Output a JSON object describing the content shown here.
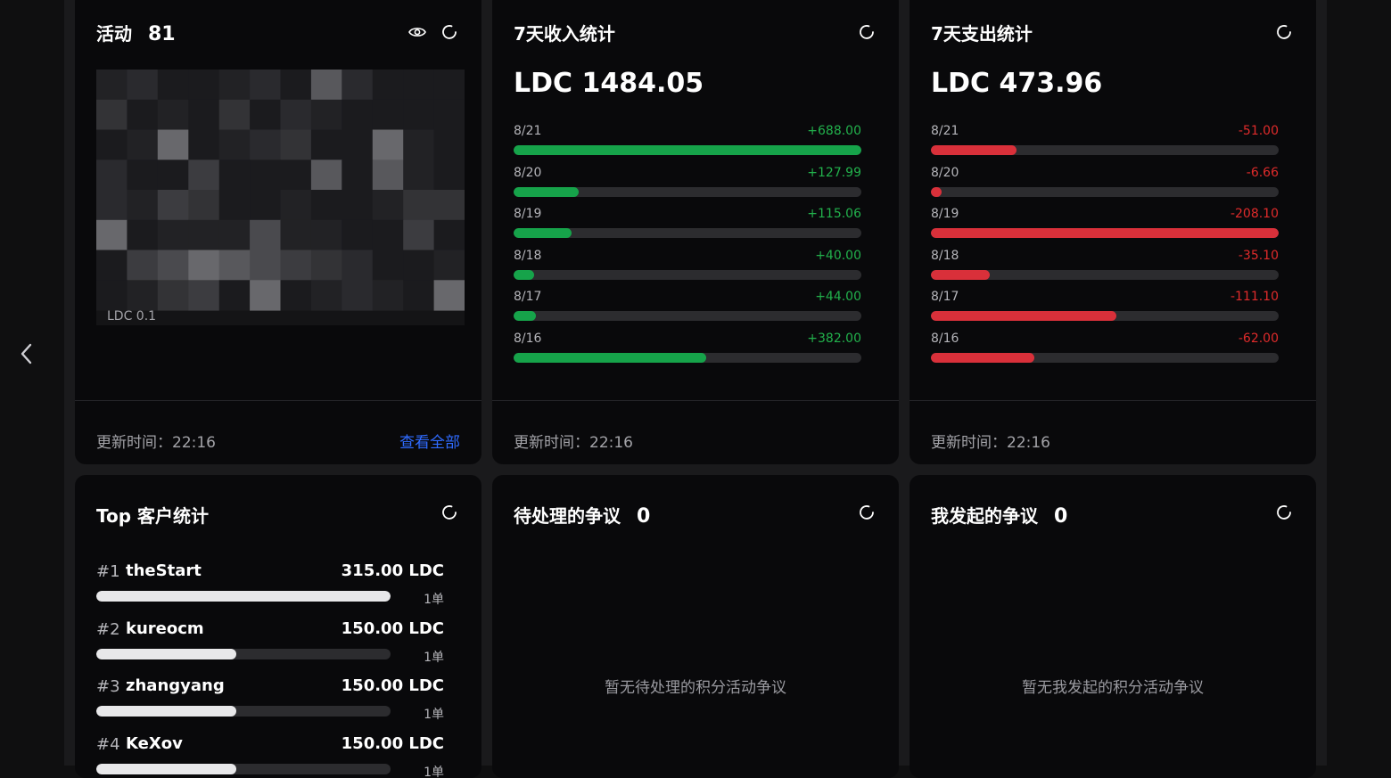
{
  "activity": {
    "title": "活动",
    "count": "81",
    "mosaic_label": "LDC 0.1",
    "updated": "更新时间：22:16",
    "view_all": "查看全部"
  },
  "income": {
    "title": "7天收入统计",
    "total": "LDC 1484.05",
    "updated": "更新时间：22:16",
    "rows": [
      {
        "date": "8/21",
        "value": "+688.00",
        "fraction": 1.0
      },
      {
        "date": "8/20",
        "value": "+127.99",
        "fraction": 0.186
      },
      {
        "date": "8/19",
        "value": "+115.06",
        "fraction": 0.167
      },
      {
        "date": "8/18",
        "value": "+40.00",
        "fraction": 0.058
      },
      {
        "date": "8/17",
        "value": "+44.00",
        "fraction": 0.064
      },
      {
        "date": "8/16",
        "value": "+382.00",
        "fraction": 0.555
      }
    ]
  },
  "expense": {
    "title": "7天支出统计",
    "total": "LDC 473.96",
    "updated": "更新时间：22:16",
    "rows": [
      {
        "date": "8/21",
        "value": "-51.00",
        "fraction": 0.245
      },
      {
        "date": "8/20",
        "value": "-6.66",
        "fraction": 0.032
      },
      {
        "date": "8/19",
        "value": "-208.10",
        "fraction": 1.0
      },
      {
        "date": "8/18",
        "value": "-35.10",
        "fraction": 0.169
      },
      {
        "date": "8/17",
        "value": "-111.10",
        "fraction": 0.534
      },
      {
        "date": "8/16",
        "value": "-62.00",
        "fraction": 0.298
      }
    ]
  },
  "top_customers": {
    "title": "Top 客户统计",
    "rows": [
      {
        "rank": "#1",
        "name": "theStart",
        "amount": "315.00 LDC",
        "orders": "1单",
        "fraction": 1.0
      },
      {
        "rank": "#2",
        "name": "kureocm",
        "amount": "150.00 LDC",
        "orders": "1单",
        "fraction": 0.476
      },
      {
        "rank": "#3",
        "name": "zhangyang",
        "amount": "150.00 LDC",
        "orders": "1单",
        "fraction": 0.476
      },
      {
        "rank": "#4",
        "name": "KeXov",
        "amount": "150.00 LDC",
        "orders": "1单",
        "fraction": 0.476
      }
    ]
  },
  "pending_disputes": {
    "title": "待处理的争议",
    "count": "0",
    "empty": "暂无待处理的积分活动争议"
  },
  "my_disputes": {
    "title": "我发起的争议",
    "count": "0",
    "empty": "暂无我发起的积分活动争议"
  },
  "colors": {
    "income": "#16a34a",
    "expense": "#d9303a",
    "link": "#2f6bff"
  }
}
